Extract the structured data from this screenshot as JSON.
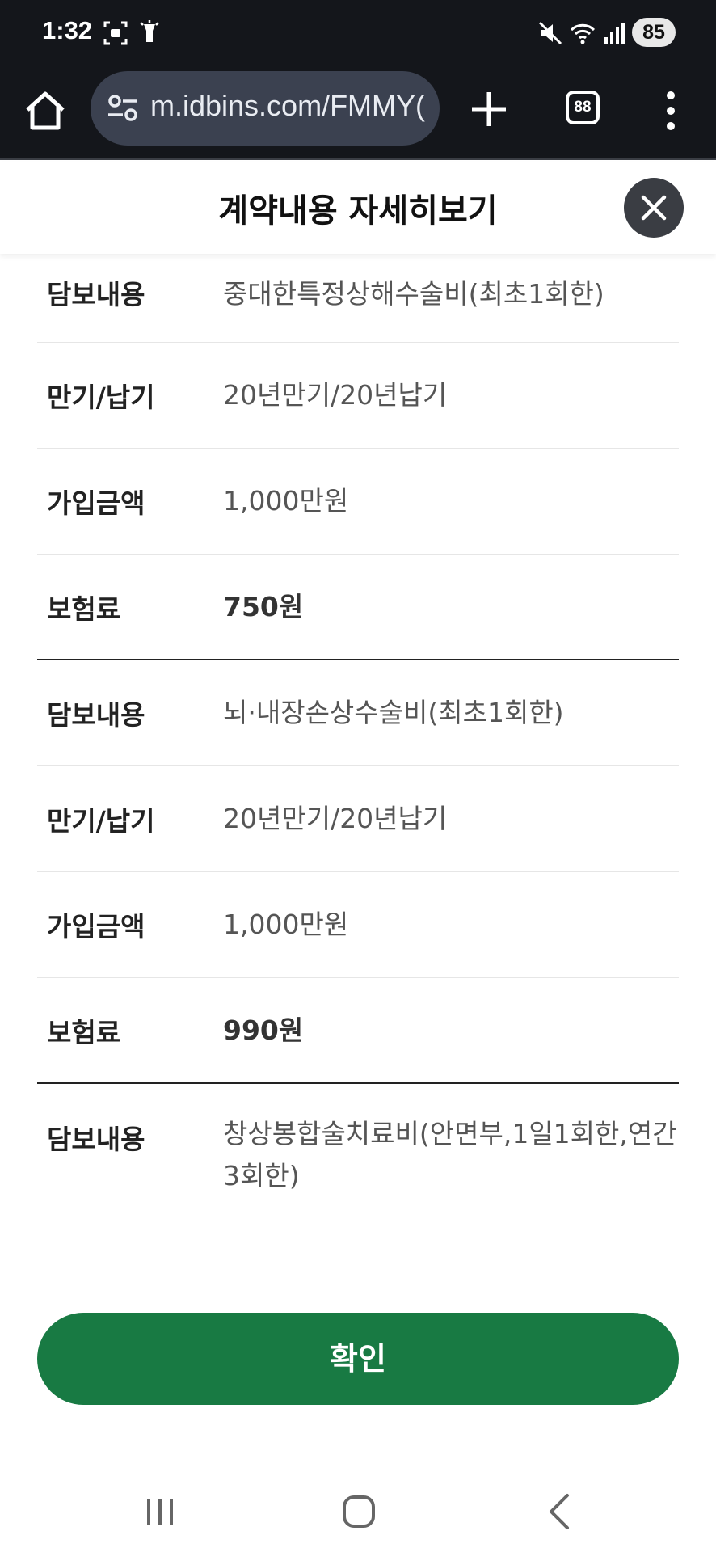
{
  "status": {
    "time": "1:32",
    "battery": "85"
  },
  "browser": {
    "url": "m.idbins.com/FMMY(",
    "tab_count": "88"
  },
  "modal": {
    "title": "계약내용 자세히보기",
    "confirm_label": "확인"
  },
  "groups": [
    {
      "rows": [
        {
          "label": "담보내용",
          "value": "중대한특정상해수술비(최초1회한)"
        },
        {
          "label": "만기/납기",
          "value": "20년만기/20년납기"
        },
        {
          "label": "가입금액",
          "value": "1,000만원"
        },
        {
          "label": "보험료",
          "value": "750원"
        }
      ]
    },
    {
      "rows": [
        {
          "label": "담보내용",
          "value": "뇌·내장손상수술비(최초1회한)"
        },
        {
          "label": "만기/납기",
          "value": "20년만기/20년납기"
        },
        {
          "label": "가입금액",
          "value": "1,000만원"
        },
        {
          "label": "보험료",
          "value": "990원"
        }
      ]
    },
    {
      "rows": [
        {
          "label": "담보내용",
          "value": "창상봉합술치료비(안면부,1일1회한,연간3회한)"
        }
      ]
    }
  ]
}
